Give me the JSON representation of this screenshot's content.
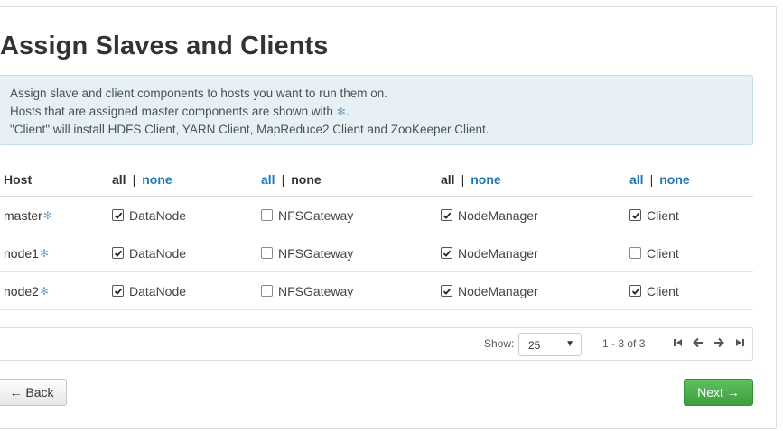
{
  "page": {
    "title": "Assign Slaves and Clients"
  },
  "info": {
    "line1": "Assign slave and client components to hosts you want to run them on.",
    "line2_prefix": "Hosts that are assigned master components are shown with",
    "line2_suffix": ".",
    "line3": "\"Client\" will install HDFS Client, YARN Client, MapReduce2 Client and ZooKeeper Client.",
    "marker_icon": "asterisk-icon"
  },
  "table": {
    "host_header": "Host",
    "columns": [
      {
        "all": "all",
        "sep": "|",
        "none": "none",
        "active": "all"
      },
      {
        "all": "all",
        "sep": "|",
        "none": "none",
        "active": "none"
      },
      {
        "all": "all",
        "sep": "|",
        "none": "none",
        "active": "all"
      },
      {
        "all": "all",
        "sep": "|",
        "none": "none",
        "active": "partial"
      }
    ],
    "rows": [
      {
        "host": "master",
        "master": true,
        "components": [
          {
            "label": "DataNode",
            "checked": true
          },
          {
            "label": "NFSGateway",
            "checked": false
          },
          {
            "label": "NodeManager",
            "checked": true
          },
          {
            "label": "Client",
            "checked": true
          }
        ]
      },
      {
        "host": "node1",
        "master": true,
        "components": [
          {
            "label": "DataNode",
            "checked": true
          },
          {
            "label": "NFSGateway",
            "checked": false
          },
          {
            "label": "NodeManager",
            "checked": true
          },
          {
            "label": "Client",
            "checked": false
          }
        ]
      },
      {
        "host": "node2",
        "master": true,
        "components": [
          {
            "label": "DataNode",
            "checked": true
          },
          {
            "label": "NFSGateway",
            "checked": false
          },
          {
            "label": "NodeManager",
            "checked": true
          },
          {
            "label": "Client",
            "checked": true
          }
        ]
      }
    ]
  },
  "pagination": {
    "show_label": "Show:",
    "page_size": "25",
    "range": "1 - 3 of 3"
  },
  "buttons": {
    "back": "← Back",
    "next": "Next →"
  },
  "colors": {
    "link": "#1b78b8",
    "info_bg": "#e7f1f5",
    "next_button": "#4cae4c"
  }
}
